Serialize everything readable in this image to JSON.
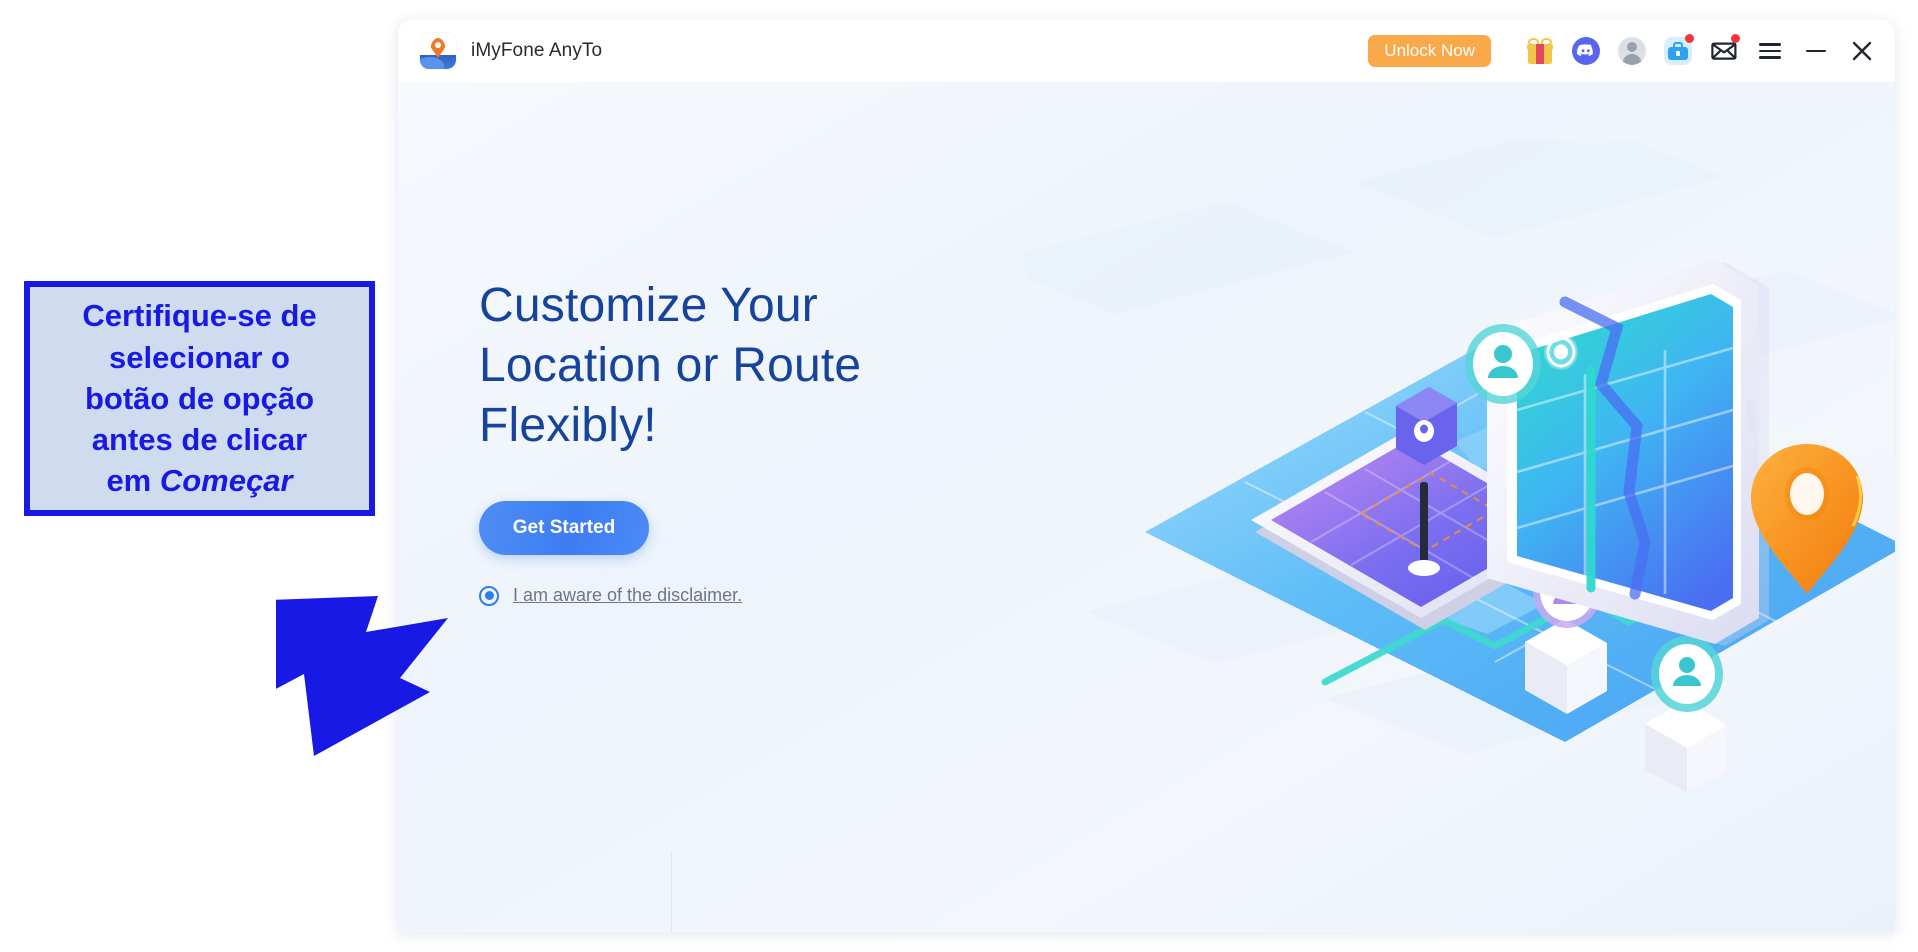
{
  "window": {
    "titlebar": {
      "app_name": "iMyFone AnyTo",
      "logo_icon": "location-pin-logo-icon",
      "unlock_label": "Unlock Now",
      "icons": [
        {
          "name": "gift-icon",
          "label": "Gift"
        },
        {
          "name": "discord-icon",
          "label": "Discord"
        },
        {
          "name": "user-avatar-icon",
          "label": "Account"
        },
        {
          "name": "toolbox-icon",
          "label": "Toolbox",
          "badge": true
        },
        {
          "name": "envelope-icon",
          "label": "Messages",
          "badge": true
        },
        {
          "name": "hamburger-menu-icon",
          "label": "Menu"
        },
        {
          "name": "minimize-icon",
          "label": "Minimize"
        },
        {
          "name": "close-icon",
          "label": "Close"
        }
      ]
    },
    "hero": {
      "heading": "Customize Your\nLocation or Route\nFlexibly!",
      "get_started_label": "Get Started",
      "disclaimer_label": "I am aware of the disclaimer.",
      "disclaimer_selected": true
    }
  },
  "annotation": {
    "line1": "Certifique-se de",
    "line2": "selecionar o",
    "line3": "botão de opção",
    "line4": "antes de clicar",
    "line5_prefix": "em ",
    "line5_emphasis": "Começar",
    "arrow_icon": "down-right-arrow-icon"
  },
  "colors": {
    "annotation_border": "#1919e6",
    "annotation_fill": "#cfdcef",
    "annotation_text": "#1919e6",
    "heading": "#16439b",
    "primary_button": "#3d7df2",
    "unlock_button": "#f9a94a",
    "radio_accent": "#2e7df0",
    "badge_dot": "#f5333f"
  }
}
